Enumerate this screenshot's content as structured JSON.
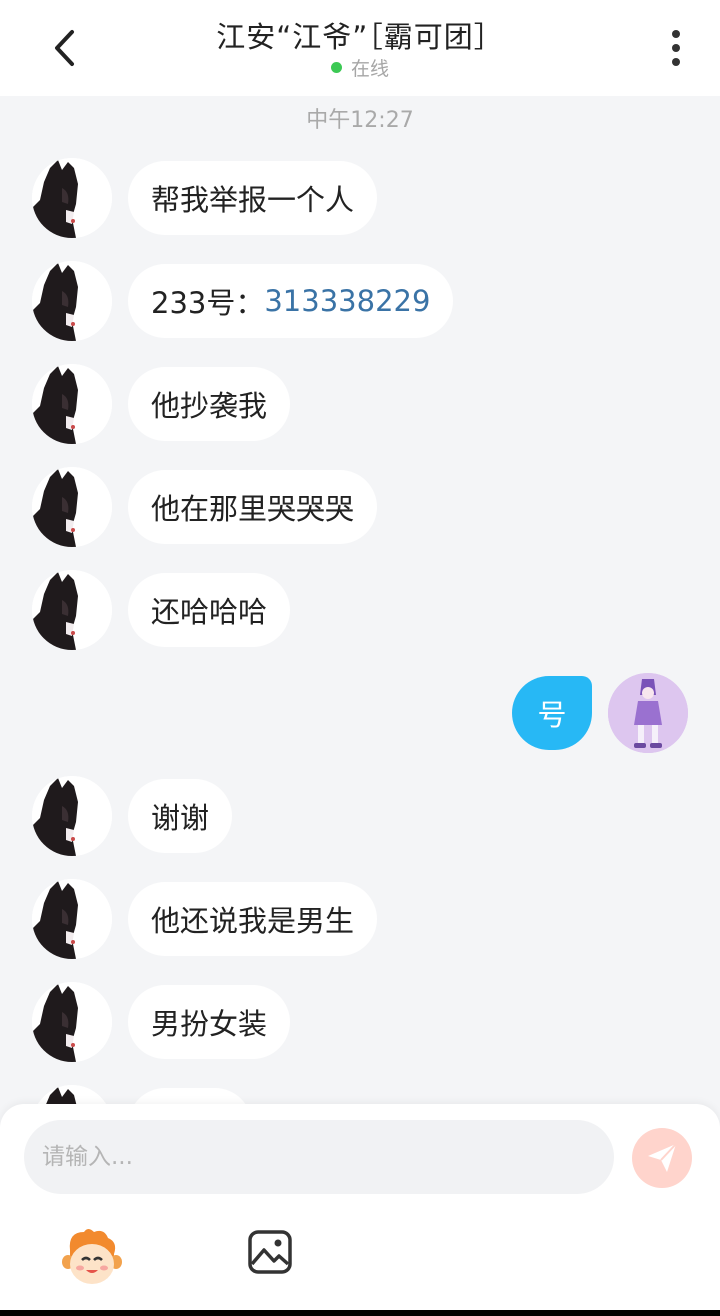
{
  "header": {
    "title": "江安“江爷”［霸可团］",
    "status": "在线",
    "status_color": "#3cc954"
  },
  "timestamp": "中午12:27",
  "messages": [
    {
      "text": "帮我举报一个人"
    },
    {
      "prefix": "233号：",
      "link": "313338229"
    },
    {
      "text": "他抄袭我"
    },
    {
      "text": "他在那里哭哭哭"
    },
    {
      "text": "还哈哈哈"
    },
    {
      "text": "号"
    },
    {
      "text": "谢谢"
    },
    {
      "text": "他还说我是男生"
    },
    {
      "text": "男扮女装"
    }
  ],
  "input": {
    "placeholder": "请输入..."
  },
  "colors": {
    "accent_bubble": "#27b8f5",
    "link": "#3a73a6",
    "send_button": "#ffd4cc"
  }
}
